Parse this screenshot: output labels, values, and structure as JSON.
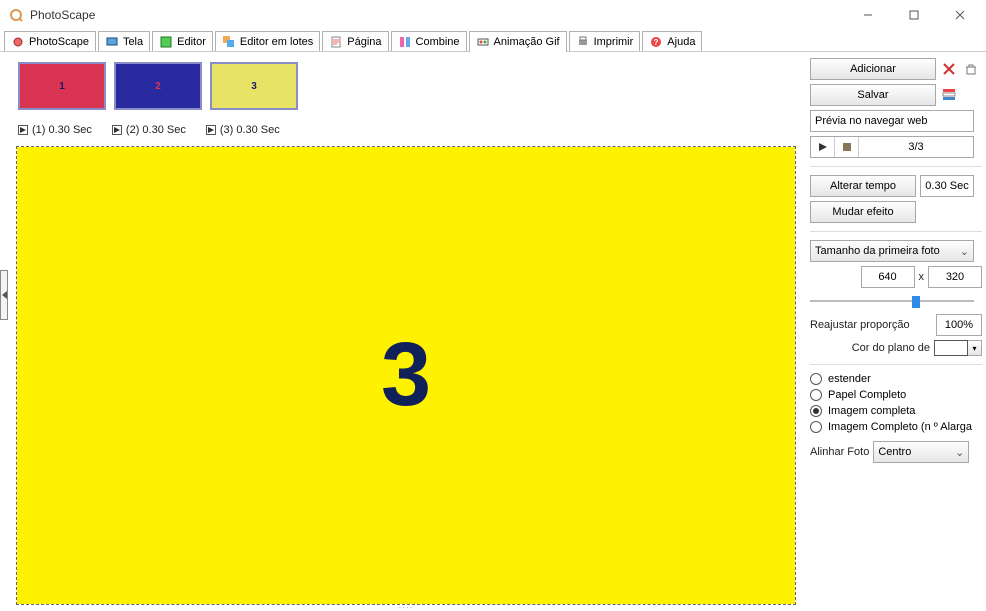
{
  "app": {
    "title": "PhotoScape"
  },
  "tabs": [
    {
      "label": "PhotoScape"
    },
    {
      "label": "Tela"
    },
    {
      "label": "Editor"
    },
    {
      "label": "Editor em lotes"
    },
    {
      "label": "Página"
    },
    {
      "label": "Combine"
    },
    {
      "label": "Animação Gif",
      "active": true
    },
    {
      "label": "Imprimir"
    },
    {
      "label": "Ajuda"
    }
  ],
  "thumbs": [
    {
      "n": "1"
    },
    {
      "n": "2"
    },
    {
      "n": "3"
    }
  ],
  "frames": [
    {
      "label": "(1) 0.30 Sec"
    },
    {
      "label": "(2) 0.30 Sec"
    },
    {
      "label": "(3) 0.30 Sec"
    }
  ],
  "preview_number": "3",
  "panel": {
    "add": "Adicionar",
    "save": "Salvar",
    "preview_web": "Prévia no navegar web",
    "counter": "3/3",
    "change_time": "Alterar tempo",
    "time_val": "0.30 Sec",
    "change_effect": "Mudar efeito",
    "size_mode": "Tamanho da primeira foto",
    "width": "640",
    "x": "x",
    "height": "320",
    "readjust": "Reajustar proporção",
    "percent": "100%",
    "bg_label": "Cor do plano de",
    "fit_options": {
      "o1": "estender",
      "o2": "Papel Completo",
      "o3": "Imagem completa",
      "o4": "Imagem Completo (n º Alarga"
    },
    "align_label": "Alinhar Foto",
    "align_value": "Centro"
  }
}
